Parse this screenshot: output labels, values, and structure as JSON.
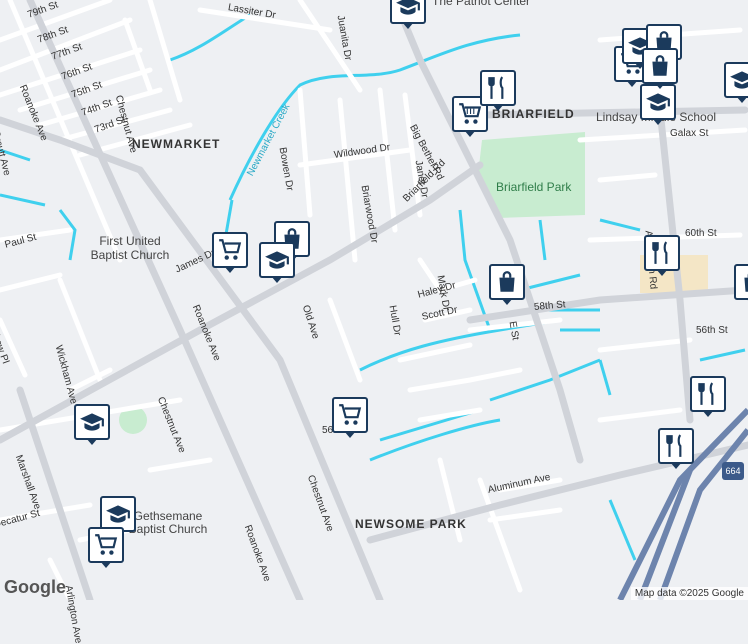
{
  "map": {
    "neighborhoods": [
      "NEWMARKET",
      "NEWSOME PARK",
      "BRIARFIELD"
    ],
    "parks": [
      "Briarfield Park"
    ],
    "pois": [
      "The Patriot Center",
      "First United Baptist Church",
      "Lindsay Middle School",
      "Gethsemane Baptist Church"
    ],
    "streets": [
      "79th St",
      "78th St",
      "77th St",
      "76th St",
      "75th St",
      "74th St",
      "73rd St",
      "Lassiter Dr",
      "Juanita Dr",
      "Roanoke Ave",
      "Chestnut Ave",
      "Orcutt Ave",
      "Newmarket Creek",
      "Bowen Dr",
      "Wildwood Dr",
      "Briarwood Dr",
      "Janet Dr",
      "Big Bethel Rd",
      "Briarfield Rd",
      "James Dr",
      "Paul St",
      "Andrew Pl",
      "Wickham Ave",
      "Old Ave",
      "Hull Dr",
      "Haley Dr",
      "Mark Dr",
      "Scott Dr",
      "58th St",
      "E St",
      "56th St",
      "60th St",
      "Aberdeen Rd",
      "Galax St",
      "Marshall Ave",
      "Decatur St",
      "Aluminum Ave",
      "56th St",
      "Arlington Ave"
    ],
    "highway_shield": "664",
    "colors": {
      "background": "#eef0f3",
      "road": "#ffffff",
      "arterial": "#c9ccd2",
      "water": "#3fd0ee",
      "park": "#c8ecd0",
      "pin": "#1b3a5c",
      "school_fill": "#f4e6c6"
    }
  },
  "markers": [
    {
      "icon": "school-icon"
    },
    {
      "icon": "shopping-cart-icon"
    },
    {
      "icon": "shopping-bag-icon"
    },
    {
      "icon": "restaurant-icon"
    },
    {
      "icon": "school-icon"
    },
    {
      "icon": "shopping-cart-icon"
    },
    {
      "icon": "school-icon"
    },
    {
      "icon": "shopping-bag-icon"
    },
    {
      "icon": "school-icon"
    },
    {
      "icon": "shopping-cart-icon"
    },
    {
      "icon": "shopping-bag-icon"
    },
    {
      "icon": "restaurant-icon"
    },
    {
      "icon": "shopping-bag-icon"
    },
    {
      "icon": "shopping-cart-icon"
    },
    {
      "icon": "school-icon"
    },
    {
      "icon": "restaurant-icon"
    },
    {
      "icon": "restaurant-icon"
    },
    {
      "icon": "school-icon"
    },
    {
      "icon": "school-icon"
    },
    {
      "icon": "shopping-cart-icon"
    }
  ],
  "footer": {
    "logo": "Google",
    "attribution": "Map data ©2025 Google"
  }
}
